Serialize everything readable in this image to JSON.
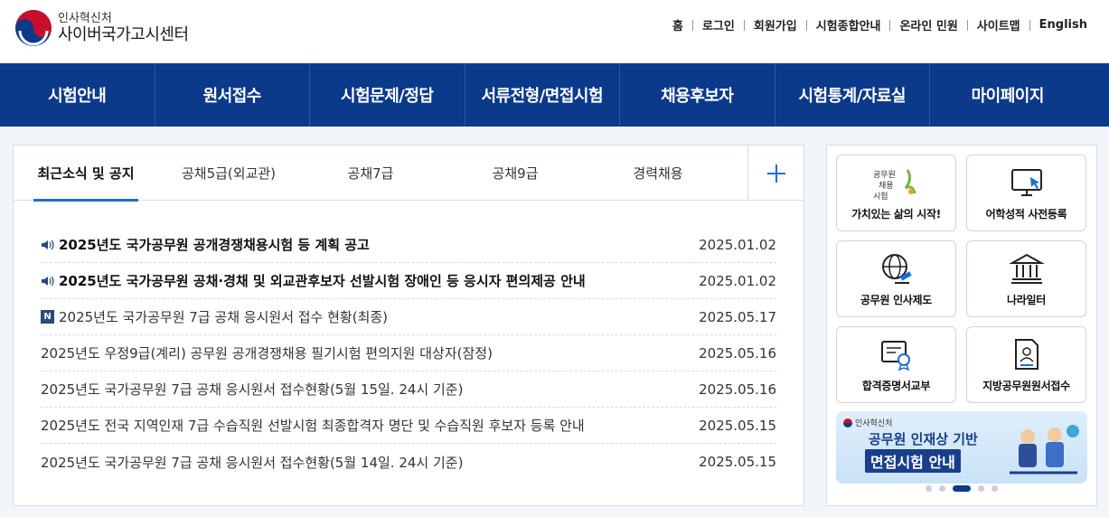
{
  "header": {
    "org_sub": "인사혁신처",
    "org_main": "사이버국가고시센터",
    "utility": [
      "홈",
      "로그인",
      "회원가입",
      "시험종합안내",
      "온라인 민원",
      "사이트맵",
      "English"
    ]
  },
  "gnb": [
    "시험안내",
    "원서접수",
    "시험문제/정답",
    "서류전형/면접시험",
    "채용후보자",
    "시험통계/자료실",
    "마이페이지"
  ],
  "notice": {
    "tabs": [
      "최근소식 및 공지",
      "공채5급(외교관)",
      "공채7급",
      "공채9급",
      "경력채용"
    ],
    "more_icon": "plus-icon",
    "items": [
      {
        "title": "2025년도 국가공무원 공개경쟁채용시험 등 계획 공고",
        "date": "2025.01.02",
        "icon": "speaker",
        "bold": true
      },
      {
        "title": "2025년도 국가공무원 공채·경채 및 외교관후보자 선발시험 장애인 등 응시자 편의제공 안내",
        "date": "2025.01.02",
        "icon": "speaker",
        "bold": true
      },
      {
        "title": "2025년도 국가공무원 7급 공채 응시원서 접수 현황(최종)",
        "date": "2025.05.17",
        "icon": "new",
        "bold": false
      },
      {
        "title": "2025년도 우정9급(계리) 공무원 공개경쟁채용 필기시험 편의지원 대상자(잠정)",
        "date": "2025.05.16",
        "icon": "",
        "bold": false
      },
      {
        "title": "2025년도 국가공무원 7급 공채 응시원서 접수현황(5월 15일. 24시 기준)",
        "date": "2025.05.16",
        "icon": "",
        "bold": false
      },
      {
        "title": "2025년도 전국 지역인재 7급 수습직원 선발시험 최종합격자 명단 및 수습직원 후보자 등록 안내",
        "date": "2025.05.15",
        "icon": "",
        "bold": false
      },
      {
        "title": "2025년도 국가공무원 7급 공채 응시원서 접수현황(5월 14일. 24시 기준)",
        "date": "2025.05.15",
        "icon": "",
        "bold": false
      }
    ],
    "new_badge": "N"
  },
  "quick": {
    "items": [
      {
        "label": "가치있는 삶의 시작!",
        "icon": "recruit-logo-icon",
        "logo_text": "공무원 채용 시험"
      },
      {
        "label": "어학성적 사전등록",
        "icon": "monitor-cursor-icon"
      },
      {
        "label": "공무원 인사제도",
        "icon": "globe-gavel-icon"
      },
      {
        "label": "나라일터",
        "icon": "government-building-icon"
      },
      {
        "label": "합격증명서교부",
        "icon": "certificate-icon"
      },
      {
        "label": "지방공무원원서접수",
        "icon": "document-person-icon"
      }
    ],
    "banner": {
      "org": "인사혁신처",
      "line1": "공무원 인재상 기반",
      "line2": "면접시험 안내"
    },
    "carousel_active": 3,
    "carousel_count": 5
  }
}
